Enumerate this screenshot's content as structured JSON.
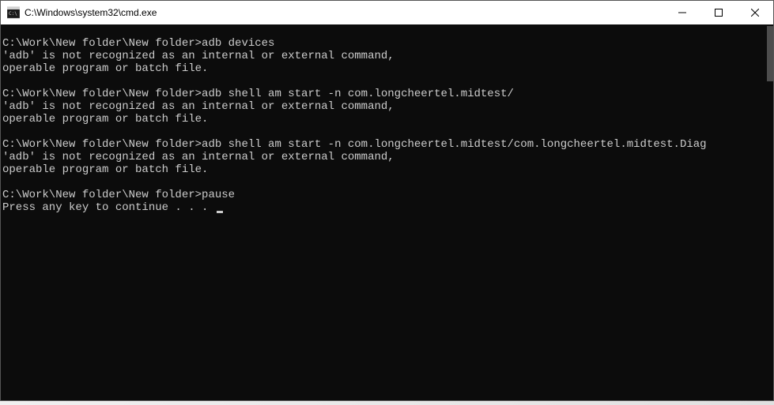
{
  "titlebar": {
    "title": "C:\\Windows\\system32\\cmd.exe"
  },
  "terminal": {
    "lines": [
      "",
      "C:\\Work\\New folder\\New folder>adb devices",
      "'adb' is not recognized as an internal or external command,",
      "operable program or batch file.",
      "",
      "C:\\Work\\New folder\\New folder>adb shell am start -n com.longcheertel.midtest/",
      "'adb' is not recognized as an internal or external command,",
      "operable program or batch file.",
      "",
      "C:\\Work\\New folder\\New folder>adb shell am start -n com.longcheertel.midtest/com.longcheertel.midtest.Diag",
      "'adb' is not recognized as an internal or external command,",
      "operable program or batch file.",
      "",
      "C:\\Work\\New folder\\New folder>pause",
      "Press any key to continue . . . "
    ]
  }
}
